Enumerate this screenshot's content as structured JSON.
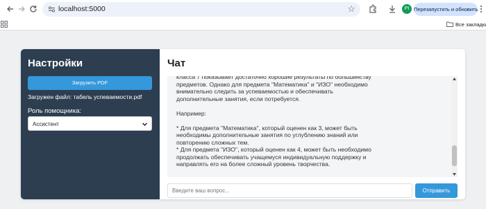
{
  "browser": {
    "url": "localhost:5000",
    "relaunch_label": "Перезапустить и обновить",
    "avatar_initials": "PI",
    "all_bookmarks_label": "Все закладки"
  },
  "sidebar": {
    "title": "Настройки",
    "upload_label": "Загрузить PDF",
    "file_status": "Загружен файл: табель успеваемости.pdf",
    "role_label": "Роль помощника:",
    "role_value": "Ассистент"
  },
  "chat": {
    "title": "Чат",
    "messages": [
      "класса 7 показывает достаточно хорошие результаты по большинству предметов. Однако для предмета \"Математика\" и \"ИЗО\" необходимо внимательно следить за успеваемостью и обеспечивать дополнительные занятия, если потребуется.",
      "",
      "Например:",
      "",
      "* Для предмета \"Математика\", который оценен как 3, может быть необходимы дополнительные занятия по углублению знаний или повторению сложных тем.",
      "* Для предмета \"ИЗО\", который оценен как 4, может быть необходимо продолжать обеспечивать учащемуся индивидуальную поддержку и направлять его на более сложный уровень творчества."
    ],
    "input_placeholder": "Введите ваш вопрос...",
    "send_label": "Отправить"
  },
  "colors": {
    "sidebar_bg": "#2c3e50",
    "accent": "#3498db",
    "page_bg": "#eef0f2",
    "messages_bg": "#f4f5f6"
  },
  "icons": [
    "back-icon",
    "forward-icon",
    "reload-icon",
    "site-info-icon",
    "bookmark-star-icon",
    "extensions-icon",
    "downloads-icon",
    "menu-dots-icon",
    "apps-grid-icon",
    "folder-icon",
    "chevron-down-icon"
  ]
}
